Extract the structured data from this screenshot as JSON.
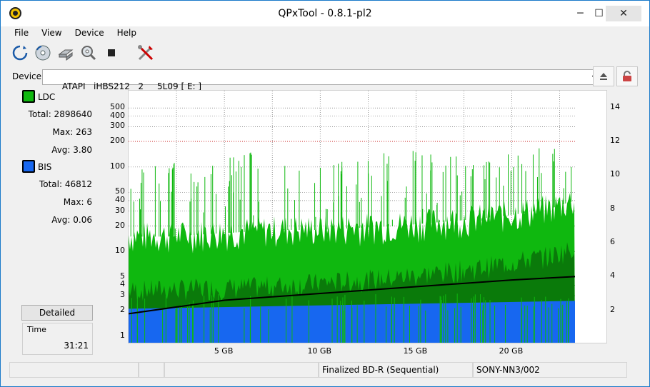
{
  "window": {
    "title": "QPxTool - 0.8.1-pl2"
  },
  "window_controls": {
    "minimize": "─",
    "maximize": "☐",
    "close": "✕"
  },
  "menu": {
    "items": [
      "File",
      "View",
      "Device",
      "Help"
    ]
  },
  "toolbar": {
    "icons": [
      "refresh-icon",
      "disc-icon",
      "drive-info-icon",
      "scan-icon",
      "stop-icon",
      "settings-icon"
    ]
  },
  "device": {
    "label": "Device:",
    "selected": "ATAPI   iHBS212   2     5L09 [ E: ]",
    "dropdown_arrow": "▼"
  },
  "stats": {
    "ldc": {
      "label": "LDC",
      "color": "#0fb80f",
      "total": "Total: 2898640",
      "max": "Max: 263",
      "avg": "Avg: 3.80"
    },
    "bis": {
      "label": "BIS",
      "color": "#1767f0",
      "total": "Total: 46812",
      "max": "Max: 6",
      "avg": "Avg: 0.06"
    }
  },
  "detailed_label": "Detailed",
  "time": {
    "label": "Time",
    "value": "31:21"
  },
  "chart_data": {
    "type": "area",
    "xlabel": "",
    "ylabel": "",
    "y_scale": "log",
    "ylim": [
      0.8,
      800
    ],
    "y2lim": [
      0,
      15
    ],
    "grid": true,
    "ticks": {
      "left": [
        "1",
        "2",
        "3",
        "4",
        "5",
        "10",
        "20",
        "30",
        "40",
        "50",
        "100",
        "200",
        "300",
        "400",
        "500"
      ],
      "right": [
        "2",
        "4",
        "6",
        "8",
        "10",
        "12",
        "14"
      ],
      "x": [
        "5 GB",
        "10 GB",
        "15 GB",
        "20 GB"
      ]
    },
    "x_range_gb": [
      0,
      23.3
    ],
    "series": [
      {
        "name": "LDC",
        "color": "#0fb80f",
        "x": [
          0,
          2,
          4,
          6,
          8,
          10,
          12,
          14,
          16,
          18,
          20,
          22,
          23.3
        ],
        "peak": [
          80,
          120,
          90,
          150,
          110,
          100,
          120,
          160,
          140,
          130,
          150,
          170,
          190
        ],
        "upper": [
          15,
          15,
          16,
          17,
          18,
          18,
          19,
          20,
          22,
          24,
          27,
          32,
          40
        ],
        "base": [
          3.5,
          3.6,
          3.7,
          3.8,
          4,
          4.3,
          4.6,
          5,
          5.6,
          6.3,
          7.5,
          9,
          11
        ]
      },
      {
        "name": "BIS",
        "color": "#1767f0",
        "x": [
          0,
          23.3
        ],
        "level": [
          2.1,
          2.6
        ]
      }
    ],
    "speed_curve": {
      "color": "#000000",
      "x": [
        0,
        5,
        10,
        15,
        20,
        23.3
      ],
      "y": [
        1.8,
        2.6,
        3.0,
        3.4,
        3.8,
        4.0
      ]
    }
  },
  "statusbar": {
    "disc": "Finalized BD-R (Sequential)",
    "media_id": "SONY-NN3/002"
  }
}
